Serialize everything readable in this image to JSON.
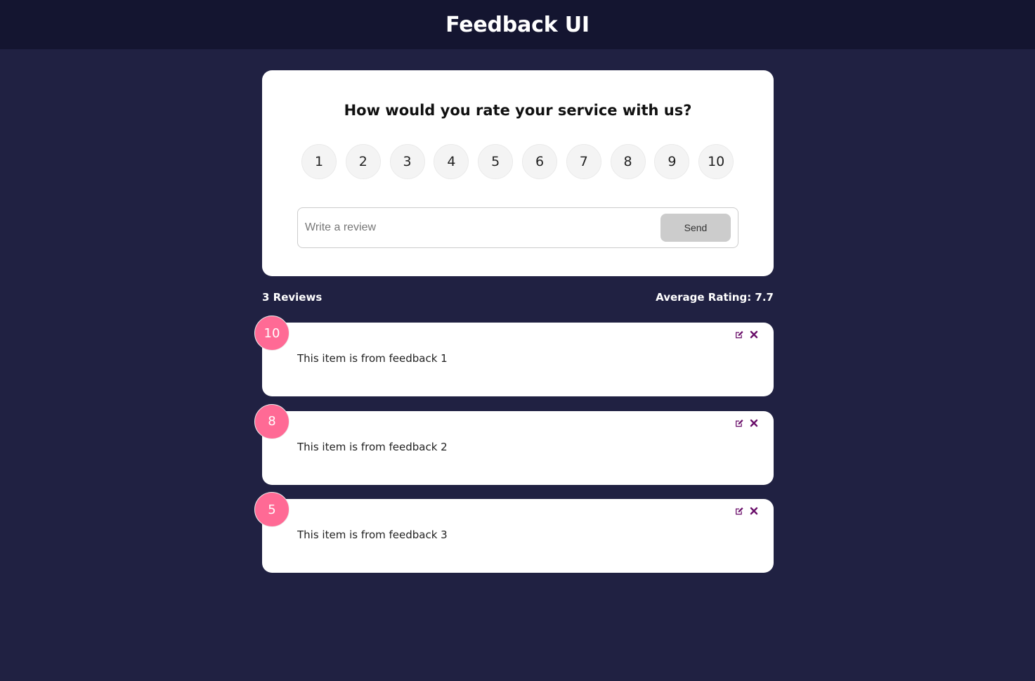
{
  "app": {
    "title": "Feedback UI"
  },
  "rating_form": {
    "question": "How would you rate your service with us?",
    "options": [
      "1",
      "2",
      "3",
      "4",
      "5",
      "6",
      "7",
      "8",
      "9",
      "10"
    ],
    "review_placeholder": "Write a review",
    "review_value": "",
    "send_label": "Send"
  },
  "stats": {
    "count_label": "3 Reviews",
    "average_label": "Average Rating: 7.7"
  },
  "feedback": [
    {
      "rating": "10",
      "text": "This item is from feedback 1"
    },
    {
      "rating": "8",
      "text": "This item is from feedback 2"
    },
    {
      "rating": "5",
      "text": "This item is from feedback 3"
    }
  ],
  "icons": {
    "edit": "edit-icon",
    "delete": "close-icon"
  },
  "colors": {
    "background": "#202142",
    "header": "#141530",
    "rating_badge": "#ff6a95",
    "icon": "#6a0f6a",
    "send_button": "#cccccc"
  }
}
